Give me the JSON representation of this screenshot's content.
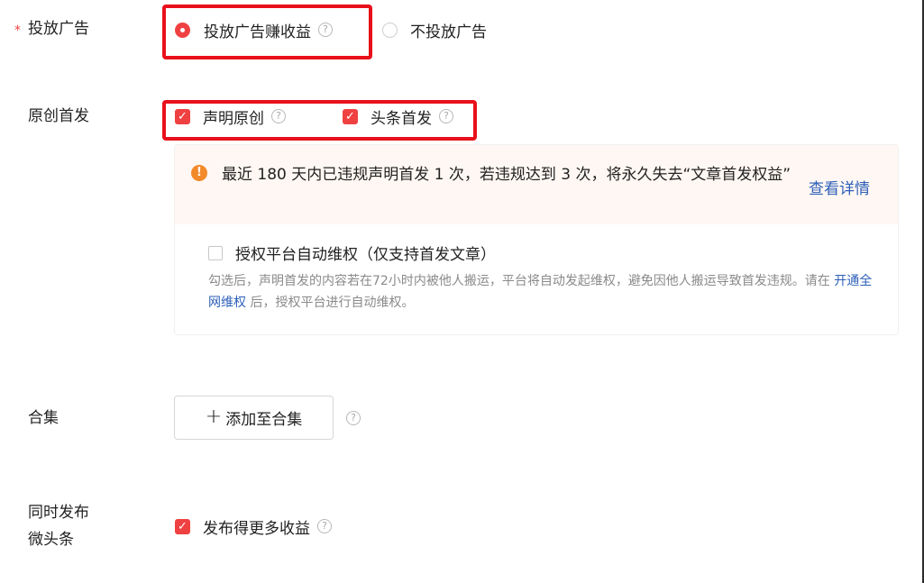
{
  "ads": {
    "label": "投放广告",
    "required_mark": "*",
    "option_on": "投放广告赚收益",
    "option_off": "不投放广告"
  },
  "original": {
    "label": "原创首发",
    "declare_original": "声明原创",
    "toutiao_first": "头条首发"
  },
  "warning": {
    "icon": "!",
    "text": "最近 180 天内已违规声明首发 1 次，若违规达到 3 次，将永久失去“文章首发权益”",
    "details_link": "查看详情"
  },
  "authorize": {
    "option": "授权平台自动维权（仅支持首发文章）",
    "desc_before": "勾选后，声明首发的内容若在72小时内被他人搬运，平台将自动发起维权，避免因他人搬运导致首发违规。请在",
    "desc_link": "开通全网维权",
    "desc_after": "后，授权平台进行自动维权。"
  },
  "collection": {
    "label": "合集",
    "button_plus": "+",
    "button_label": "添加至合集"
  },
  "weitoutiao": {
    "label_line1": "同时发布",
    "label_line2": "微头条",
    "option": "发布得更多收益"
  },
  "help_glyph": "?",
  "check_glyph": "✓",
  "colors": {
    "accent": "#f04142",
    "link": "#2d5fb8",
    "warning_icon": "#f28a2a",
    "highlight_box": "#e8101a"
  }
}
